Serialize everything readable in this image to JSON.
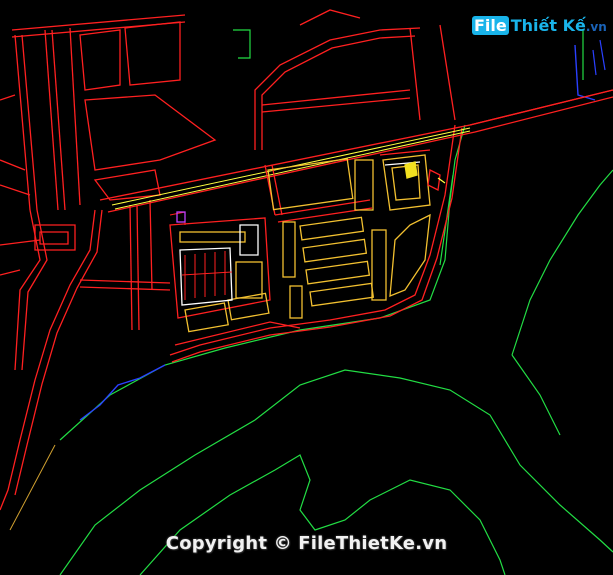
{
  "watermark": {
    "logo_part1": "File",
    "logo_part2": "Thiết Kế",
    "logo_part3": ".vn",
    "copyright": "Copyright © FileThietKe.vn"
  },
  "colors": {
    "background": "#000000",
    "road": "#ff2020",
    "road_dark": "#c01818",
    "block_outline": "#ffffff",
    "block_fill": "#f2c030",
    "highway_center": "#ffff40",
    "coastline": "#22dd44",
    "water_edge": "#2a40ff",
    "parcel": "#b02020",
    "logo_blue": "#19b4ea",
    "logo_dark": "#1a63b8"
  }
}
